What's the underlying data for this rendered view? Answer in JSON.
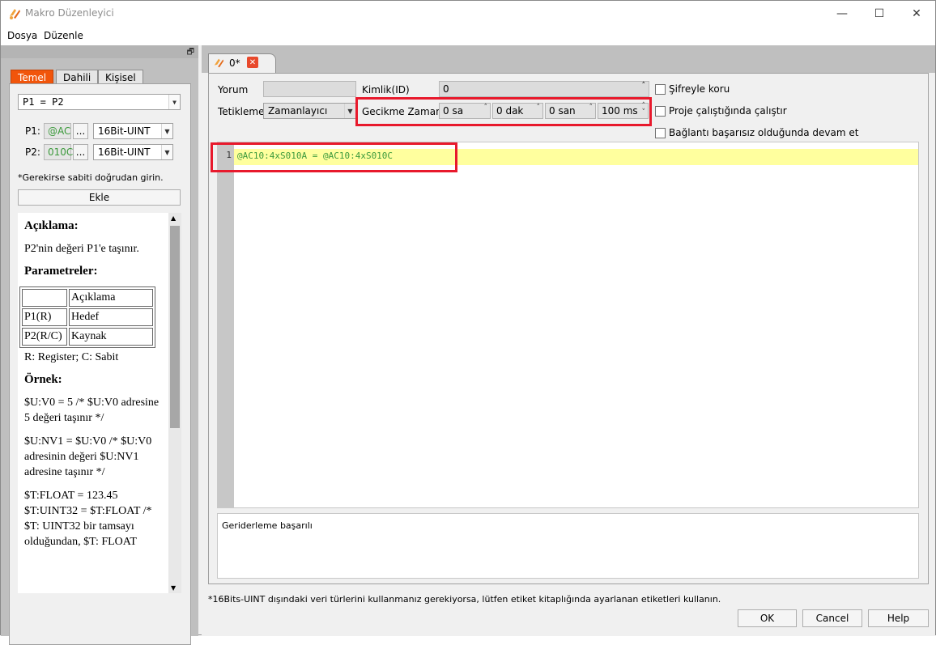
{
  "window": {
    "title": "Makro Düzenleyici",
    "minimize": "—",
    "maximize": "☐",
    "close": "✕"
  },
  "menu": {
    "items": [
      {
        "label": "Dosya"
      },
      {
        "label": "Düzenle"
      }
    ]
  },
  "left": {
    "restore_icon": "🗗",
    "tabs": [
      {
        "label": "Temel"
      },
      {
        "label": "Dahili"
      },
      {
        "label": "Kişisel"
      }
    ],
    "command_select": "P1 = P2",
    "p1": {
      "label": "P1:",
      "value": "@AC",
      "browse": "...",
      "type": "16Bit-UINT"
    },
    "p2": {
      "label": "P2:",
      "value": "010C",
      "browse": "...",
      "type": "16Bit-UINT"
    },
    "hint": "*Gerekirse sabiti doğrudan girin.",
    "add_button": "Ekle",
    "description": {
      "heading": "Açıklama:",
      "text": "P2'nin değeri P1'e taşınır.",
      "params_heading": "Parametreler:",
      "table_header": [
        "",
        "Açıklama"
      ],
      "table_rows": [
        [
          "P1(R)",
          "Hedef"
        ],
        [
          "P2(R/C)",
          "Kaynak"
        ]
      ],
      "legend": "R: Register; C: Sabit",
      "example_heading": "Örnek:",
      "example1": "$U:V0 = 5 /* $U:V0 adresine 5 değeri taşınır */",
      "example2": "$U:NV1 = $U:V0 /* $U:V0 adresinin değeri $U:NV1 adresine taşınır */",
      "example3": "$T:FLOAT = 123.45 $T:UINT32 = $T:FLOAT /* $T: UINT32 bir tamsayı olduğundan, $T: FLOAT"
    }
  },
  "editor_tab": {
    "label": "0*",
    "close_icon": "✕"
  },
  "form": {
    "yorum_label": "Yorum",
    "yorum_value": "",
    "kimlik_label": "Kimlik(ID)",
    "kimlik_value": "0",
    "tetikleme_label": "Tetikleme",
    "tetikleme_value": "Zamanlayıcı",
    "gecikme_label": "Gecikme Zamanı",
    "delay": {
      "hours": "0 sa",
      "minutes": "0 dak",
      "seconds": "0 san",
      "ms": "100 ms"
    },
    "checkboxes": [
      {
        "label": "Şifreyle koru"
      },
      {
        "label": "Proje çalıştığında çalıştır"
      },
      {
        "label": "Bağlantı başarısız olduğunda devam et"
      }
    ]
  },
  "code": {
    "line_number": "1",
    "line": "@AC10:4xS010A = @AC10:4xS010C"
  },
  "output": {
    "text": "Geriderleme başarılı"
  },
  "footer": {
    "note": "*16Bits-UINT dışındaki veri türlerini kullanmanız gerekiyorsa, lütfen etiket kitaplığında ayarlanan etiketleri kullanın.",
    "ok": "OK",
    "cancel": "Cancel",
    "help": "Help"
  },
  "colors": {
    "accent_tab": "#f1550b",
    "highlight_border": "#e8192c",
    "code_text": "#3c9a3c",
    "line_highlight": "#ffff9e"
  }
}
